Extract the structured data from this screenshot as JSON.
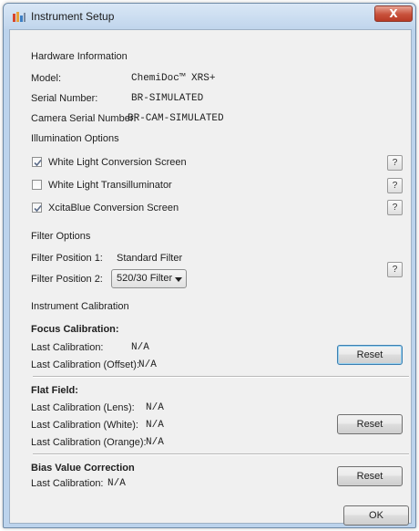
{
  "window": {
    "title": "Instrument Setup",
    "close_label": "X",
    "accent": "#c8513b"
  },
  "hardware": {
    "heading": "Hardware Information",
    "model_label": "Model:",
    "model_value": "ChemiDoc™ XRS+",
    "serial_label": "Serial Number:",
    "serial_value": "BR-SIMULATED",
    "camera_label": "Camera Serial Number:",
    "camera_value": "BR-CAM-SIMULATED"
  },
  "illumination": {
    "heading": "Illumination Options",
    "options": [
      {
        "label": "White Light Conversion Screen",
        "checked": true
      },
      {
        "label": "White Light Transilluminator",
        "checked": false
      },
      {
        "label": "XcitaBlue Conversion Screen",
        "checked": true
      }
    ],
    "help_label": "?"
  },
  "filter": {
    "heading": "Filter Options",
    "pos1_label": "Filter Position 1:",
    "pos1_value": "Standard Filter",
    "pos2_label": "Filter Position 2:",
    "pos2_selected": "520/30 Filter",
    "help_label": "?"
  },
  "calibration": {
    "heading": "Instrument Calibration",
    "focus": {
      "title": "Focus Calibration:",
      "last_label": "Last Calibration:",
      "last_value": "N/A",
      "offset_label": "Last Calibration (Offset):",
      "offset_value": "N/A",
      "reset_label": "Reset"
    },
    "flat": {
      "title": "Flat Field:",
      "lens_label": "Last Calibration (Lens):",
      "lens_value": "N/A",
      "white_label": "Last Calibration (White):",
      "white_value": "N/A",
      "orange_label": "Last Calibration (Orange):",
      "orange_value": "N/A",
      "reset_label": "Reset"
    },
    "bias": {
      "title": "Bias Value Correction",
      "last_label": "Last Calibration:",
      "last_value": "N/A",
      "reset_label": "Reset"
    }
  },
  "footer": {
    "ok_label": "OK"
  }
}
